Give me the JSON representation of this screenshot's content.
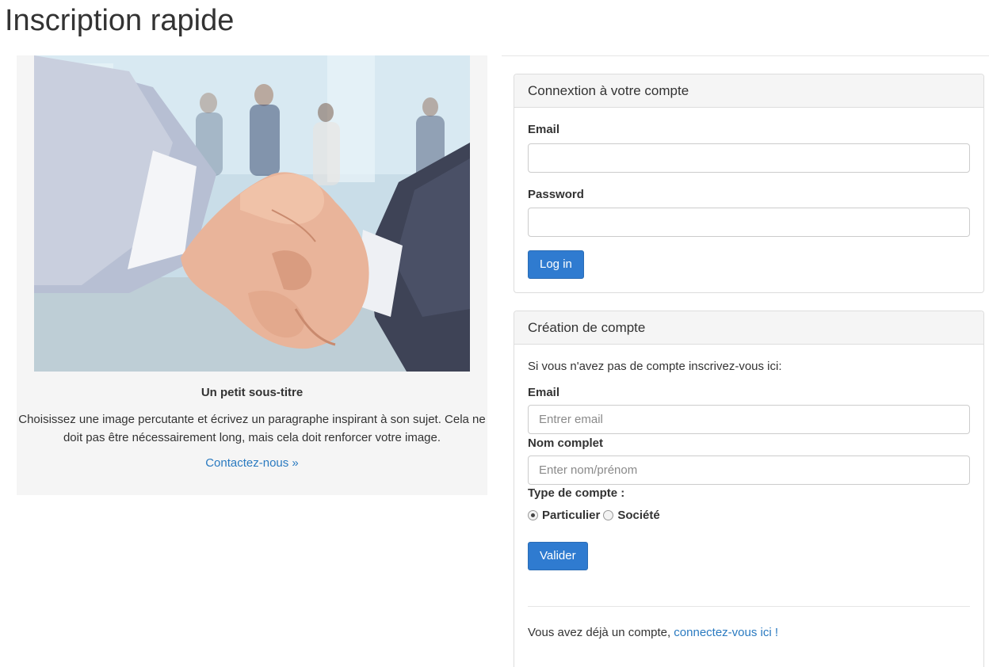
{
  "page": {
    "title": "Inscription rapide"
  },
  "left": {
    "image_alt": "handshake",
    "subtitle": "Un petit sous-titre",
    "paragraph": "Choisissez une image percutante et écrivez un paragraphe inspirant à son sujet. Cela ne doit pas être nécessairement long, mais cela doit renforcer votre image.",
    "contact_link": "Contactez-nous »"
  },
  "login": {
    "heading": "Connextion à votre compte",
    "email_label": "Email",
    "email_value": "",
    "password_label": "Password",
    "password_value": "",
    "submit_label": "Log in"
  },
  "signup": {
    "heading": "Création de compte",
    "intro": "Si vous n'avez pas de compte inscrivez-vous ici:",
    "email_label": "Email",
    "email_placeholder": "Entrer email",
    "name_label": "Nom complet",
    "name_placeholder": "Enter nom/prénom",
    "account_type_label": "Type de compte :",
    "account_types": [
      {
        "label": "Particulier",
        "selected": true
      },
      {
        "label": "Société",
        "selected": false
      }
    ],
    "submit_label": "Valider",
    "footer_text": "Vous avez déjà un compte, ",
    "footer_link": "connectez-vous ici !"
  },
  "colors": {
    "primary": "#2f7bd0",
    "link": "#2a7ac0",
    "panel_heading_bg": "#f5f5f5",
    "left_panel_bg": "#f5f5f5"
  }
}
